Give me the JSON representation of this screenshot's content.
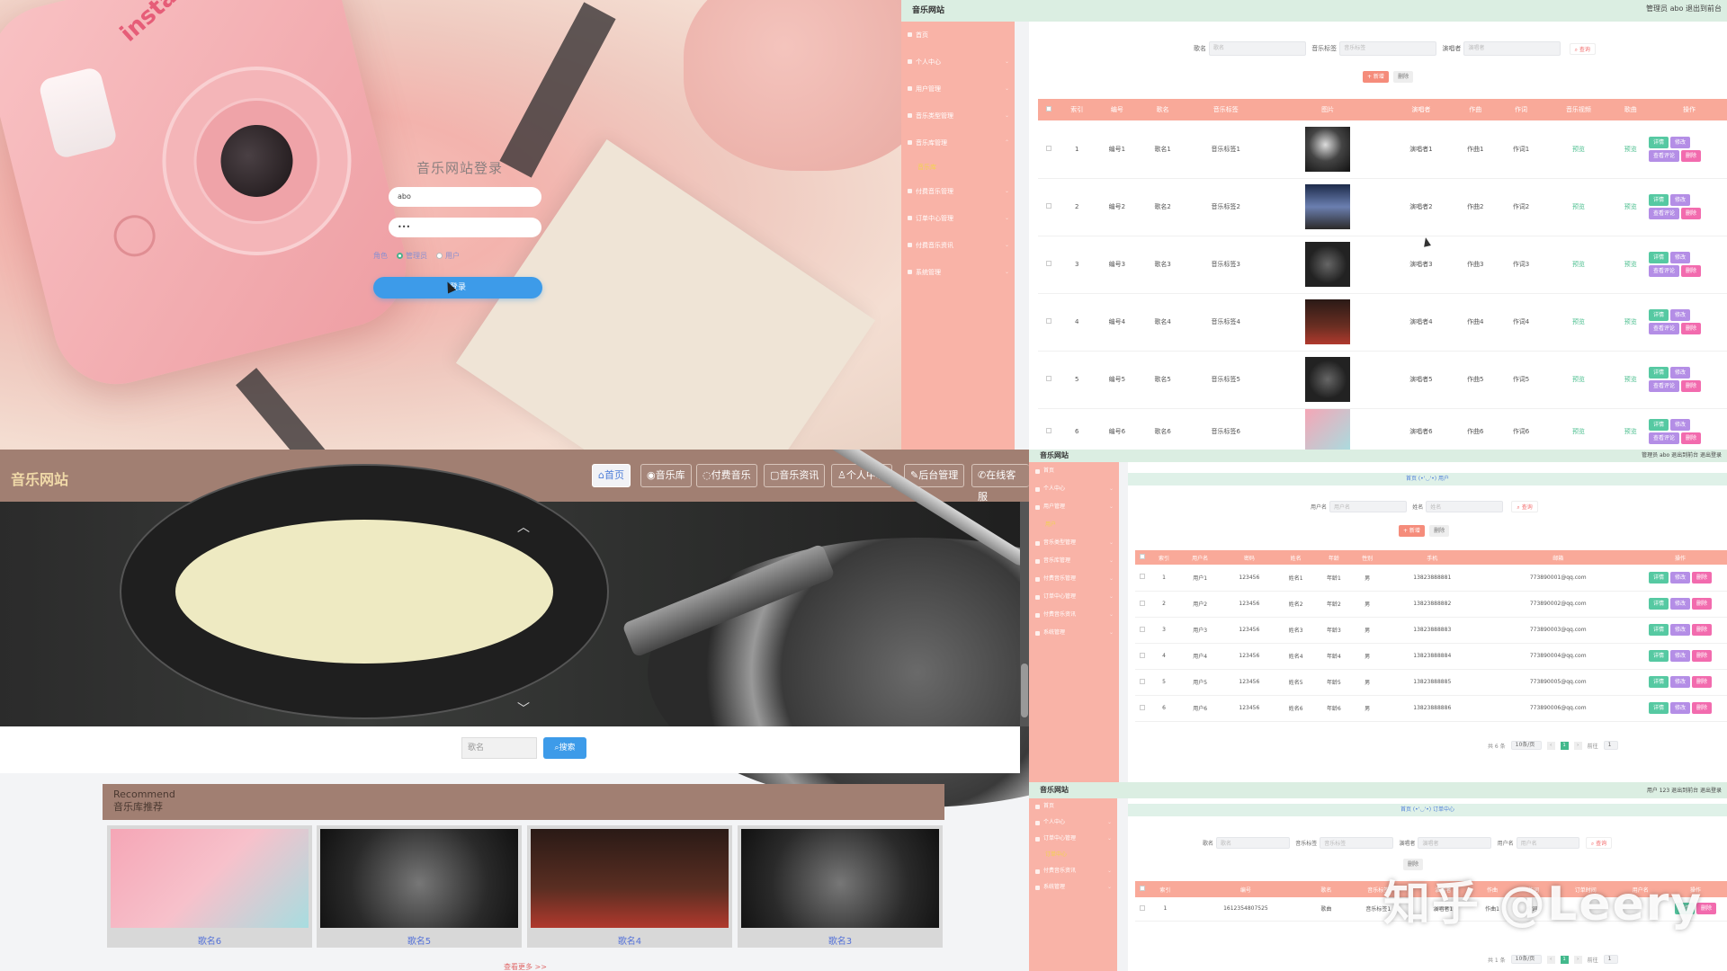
{
  "login": {
    "title": "音乐网站登录",
    "username_value": "abo",
    "password_value": "•••",
    "role_label": "角色",
    "role_options": [
      "管理员",
      "用户"
    ],
    "login_button": "登录",
    "camera_brand": "instax"
  },
  "admin1": {
    "site_title": "音乐网站",
    "top_right": "管理员 abo   退出到前台",
    "sidebar": [
      "首页",
      "个人中心",
      "用户管理",
      "音乐类型管理",
      "音乐库管理",
      "音乐库",
      "付费音乐管理",
      "订单中心管理",
      "付费音乐资讯",
      "系统管理"
    ],
    "search": {
      "label1": "歌名",
      "ph1": "歌名",
      "label2": "音乐标签",
      "ph2": "音乐标签",
      "label3": "演唱者",
      "ph3": "演唱者",
      "btn": "查询"
    },
    "buttons": {
      "add": "+ 新增",
      "delete": "删除"
    },
    "columns": [
      "索引",
      "编号",
      "歌名",
      "音乐标签",
      "图片",
      "演唱者",
      "作曲",
      "作词",
      "音乐视频",
      "歌曲",
      "操作"
    ],
    "rows": [
      {
        "idx": "1",
        "no": "编号1",
        "name": "歌名1",
        "tag": "音乐标签1",
        "singer": "演唱者1",
        "composer": "作曲1",
        "lyric": "作词1",
        "video": "预览",
        "song": "预览"
      },
      {
        "idx": "2",
        "no": "编号2",
        "name": "歌名2",
        "tag": "音乐标签2",
        "singer": "演唱者2",
        "composer": "作曲2",
        "lyric": "作词2",
        "video": "预览",
        "song": "预览"
      },
      {
        "idx": "3",
        "no": "编号3",
        "name": "歌名3",
        "tag": "音乐标签3",
        "singer": "演唱者3",
        "composer": "作曲3",
        "lyric": "作词3",
        "video": "预览",
        "song": "预览"
      },
      {
        "idx": "4",
        "no": "编号4",
        "name": "歌名4",
        "tag": "音乐标签4",
        "singer": "演唱者4",
        "composer": "作曲4",
        "lyric": "作词4",
        "video": "预览",
        "song": "预览"
      },
      {
        "idx": "5",
        "no": "编号5",
        "name": "歌名5",
        "tag": "音乐标签5",
        "singer": "演唱者5",
        "composer": "作曲5",
        "lyric": "作词5",
        "video": "预览",
        "song": "预览"
      },
      {
        "idx": "6",
        "no": "编号6",
        "name": "歌名6",
        "tag": "音乐标签6",
        "singer": "演唱者6",
        "composer": "作曲6",
        "lyric": "作词6",
        "video": "预览",
        "song": "预览"
      }
    ],
    "row_actions": {
      "detail": "详情",
      "edit": "修改",
      "comment": "查看评论",
      "delete": "删除"
    }
  },
  "site": {
    "logo": "音乐网站",
    "nav": [
      "首页",
      "音乐库",
      "付费音乐",
      "音乐资讯",
      "个人中心",
      "后台管理",
      "在线客服"
    ],
    "search_placeholder": "歌名",
    "search_button": "搜索",
    "recommend_en": "Recommend",
    "recommend_cn": "音乐库推荐",
    "cards": [
      "歌名6",
      "歌名5",
      "歌名4",
      "歌名3"
    ],
    "more": "查看更多 >>"
  },
  "admin2": {
    "site_title": "音乐网站",
    "top_right": "管理员 abo   退出到前台   退出登录",
    "crumb": "首页 (•'◡'•) 用户",
    "sidebar": [
      "首页",
      "个人中心",
      "用户管理",
      "用户",
      "音乐类型管理",
      "音乐库管理",
      "付费音乐管理",
      "订单中心管理",
      "付费音乐资讯",
      "系统管理"
    ],
    "search": {
      "label1": "用户名",
      "ph1": "用户名",
      "label2": "姓名",
      "ph2": "姓名",
      "btn": "查询"
    },
    "buttons": {
      "add": "+ 新增",
      "delete": "删除"
    },
    "columns": [
      "索引",
      "用户名",
      "密码",
      "姓名",
      "年龄",
      "性别",
      "手机",
      "邮箱",
      "操作"
    ],
    "rows": [
      {
        "idx": "1",
        "user": "用户1",
        "pwd": "123456",
        "name": "姓名1",
        "age": "年龄1",
        "sex": "男",
        "phone": "13823888881",
        "mail": "773890001@qq.com"
      },
      {
        "idx": "2",
        "user": "用户2",
        "pwd": "123456",
        "name": "姓名2",
        "age": "年龄2",
        "sex": "男",
        "phone": "13823888882",
        "mail": "773890002@qq.com"
      },
      {
        "idx": "3",
        "user": "用户3",
        "pwd": "123456",
        "name": "姓名3",
        "age": "年龄3",
        "sex": "男",
        "phone": "13823888883",
        "mail": "773890003@qq.com"
      },
      {
        "idx": "4",
        "user": "用户4",
        "pwd": "123456",
        "name": "姓名4",
        "age": "年龄4",
        "sex": "男",
        "phone": "13823888884",
        "mail": "773890004@qq.com"
      },
      {
        "idx": "5",
        "user": "用户5",
        "pwd": "123456",
        "name": "姓名5",
        "age": "年龄5",
        "sex": "男",
        "phone": "13823888885",
        "mail": "773890005@qq.com"
      },
      {
        "idx": "6",
        "user": "用户6",
        "pwd": "123456",
        "name": "姓名6",
        "age": "年龄6",
        "sex": "男",
        "phone": "13823888886",
        "mail": "773890006@qq.com"
      }
    ],
    "row_actions": {
      "detail": "详情",
      "edit": "修改",
      "delete": "删除"
    },
    "pager": {
      "total": "共 6 条",
      "size": "10条/页",
      "page": "1",
      "goto": "前往",
      "goto_val": "1"
    }
  },
  "admin3": {
    "site_title": "音乐网站",
    "top_right": "用户 123   退出到前台   退出登录",
    "crumb": "首页 (•'◡'•) 订单中心",
    "sidebar": [
      "首页",
      "个人中心",
      "订单中心管理",
      "订单中心",
      "付费音乐资讯",
      "系统管理"
    ],
    "search": {
      "label1": "歌名",
      "ph1": "歌名",
      "label2": "音乐标签",
      "ph2": "音乐标签",
      "label3": "演唱者",
      "ph3": "演唱者",
      "label4": "用户名",
      "ph4": "用户名",
      "btn": "查询"
    },
    "buttons": {
      "delete": "删除"
    },
    "columns": [
      "索引",
      "编号",
      "歌名",
      "音乐标签",
      "演唱者",
      "作曲",
      "作词",
      "订单时间",
      "用户名",
      "操作"
    ],
    "rows": [
      {
        "idx": "1",
        "no": "1612354807525",
        "name": "歌曲",
        "tag": "音乐标签1",
        "singer": "演唱者1",
        "composer": "作曲1",
        "lyric": "作词1",
        "time": "",
        "user": ""
      }
    ],
    "row_actions": {
      "detail": "详情",
      "delete": "删除"
    },
    "pager": {
      "total": "共 1 条",
      "size": "10条/页",
      "page": "1",
      "goto": "前往",
      "goto_val": "1"
    }
  },
  "watermark": "知乎 @Leery"
}
